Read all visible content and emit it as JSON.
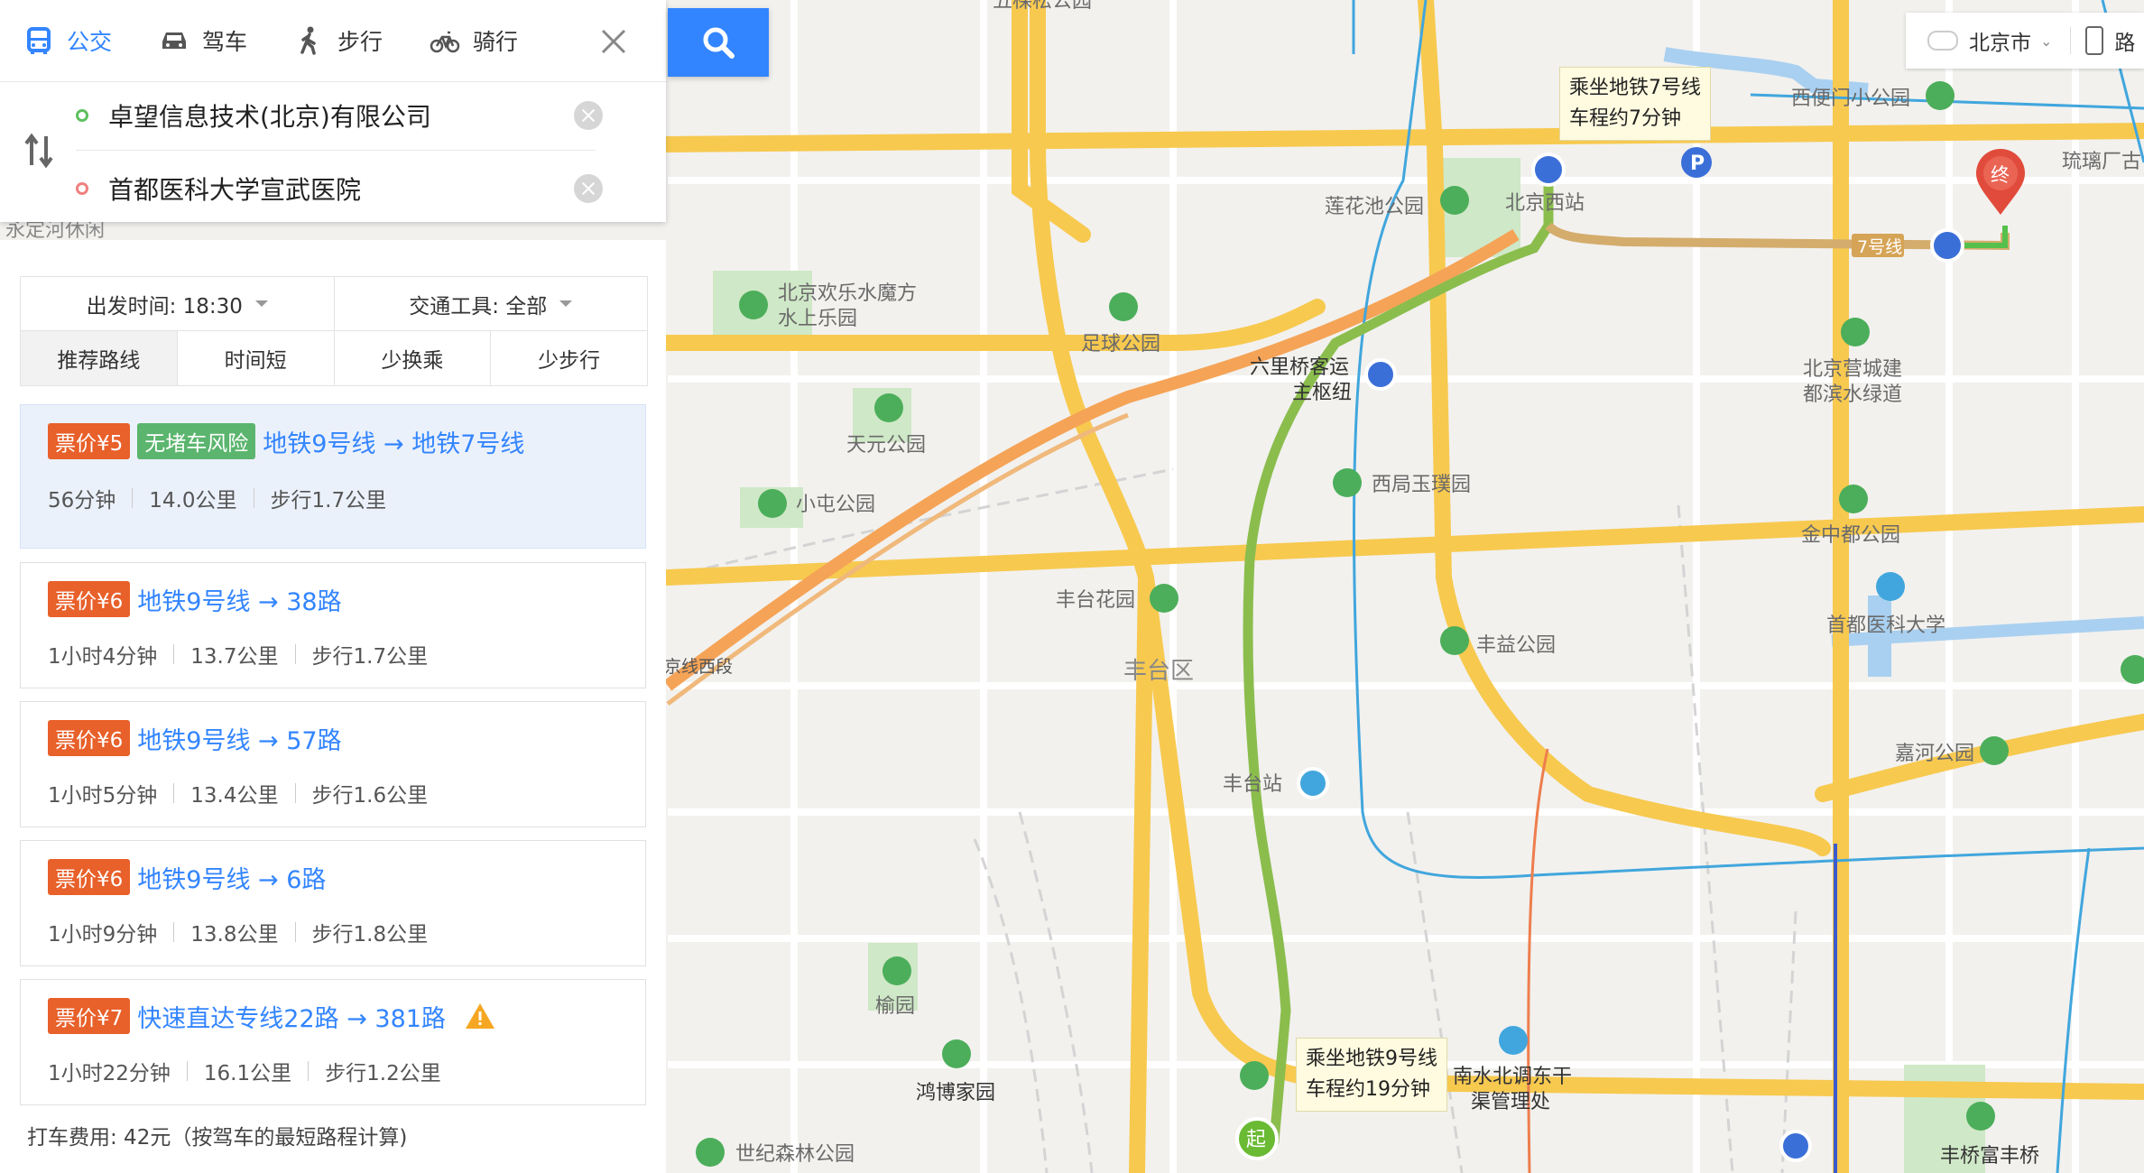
{
  "modes": [
    {
      "label": "公交",
      "icon": "bus-icon",
      "active": true
    },
    {
      "label": "驾车",
      "icon": "car-icon",
      "active": false
    },
    {
      "label": "步行",
      "icon": "walk-icon",
      "active": false
    },
    {
      "label": "骑行",
      "icon": "bike-icon",
      "active": false
    }
  ],
  "route": {
    "origin": "卓望信息技术(北京)有限公司",
    "destination": "首都医科大学宣武医院"
  },
  "filters": {
    "depart": "出发时间: 18:30",
    "tools": "交通工具: 全部",
    "sorts": [
      "推荐路线",
      "时间短",
      "少换乘",
      "少步行"
    ]
  },
  "routes": [
    {
      "price": "票价¥5",
      "tag": "无堵车风险",
      "title": "地铁9号线 → 地铁7号线",
      "time": "56分钟",
      "dist": "14.0公里",
      "walk": "步行1.7公里",
      "warn": false
    },
    {
      "price": "票价¥6",
      "tag": "",
      "title": "地铁9号线 → 38路",
      "time": "1小时4分钟",
      "dist": "13.7公里",
      "walk": "步行1.7公里",
      "warn": false
    },
    {
      "price": "票价¥6",
      "tag": "",
      "title": "地铁9号线 → 57路",
      "time": "1小时5分钟",
      "dist": "13.4公里",
      "walk": "步行1.6公里",
      "warn": false
    },
    {
      "price": "票价¥6",
      "tag": "",
      "title": "地铁9号线 → 6路",
      "time": "1小时9分钟",
      "dist": "13.8公里",
      "walk": "步行1.8公里",
      "warn": false
    },
    {
      "price": "票价¥7",
      "tag": "",
      "title": "快速直达专线22路 → 381路",
      "time": "1小时22分钟",
      "dist": "16.1公里",
      "walk": "步行1.2公里",
      "warn": true
    }
  ],
  "taxi": "打车费用: 42元（按驾车的最短路程计算)",
  "city": "北京市",
  "city_right": "路",
  "map": {
    "tip_top": [
      "乘坐地铁7号线",
      "车程约7分钟"
    ],
    "tip_bottom": [
      "乘坐地铁9号线",
      "车程约19分钟"
    ],
    "line7_label": "7号线",
    "start_label": "起",
    "end_label": "终",
    "places": {
      "p1": "五棵松公园",
      "p2": "西便门小公园",
      "p3": "琉璃厂古",
      "p4": "莲花池公园",
      "p5": "北京西站",
      "p6": "北京欢乐水魔方",
      "p7": "水上乐园",
      "p8": "足球公园",
      "p9": "北京营城建",
      "p10": "都滨水绿道",
      "p11": "六里桥客运",
      "p12": "主枢纽",
      "p13": "天元公园",
      "p14": "西局玉璞园",
      "p15": "小屯公园",
      "p16": "金中都公园",
      "p17": "首都医科大学",
      "p18": "丰台花园",
      "p19": "丰益公园",
      "p20": "丰台区",
      "p21": "嘉河公园",
      "p22": "丰台站",
      "p23": "榆园",
      "p24": "鸿博家园",
      "p25": "南水北调东干",
      "p26": "渠管理处",
      "p27": "世纪森林公园",
      "p28": "丰桥富丰桥",
      "p29": "永定河休闲",
      "p30": "京线西段"
    }
  }
}
